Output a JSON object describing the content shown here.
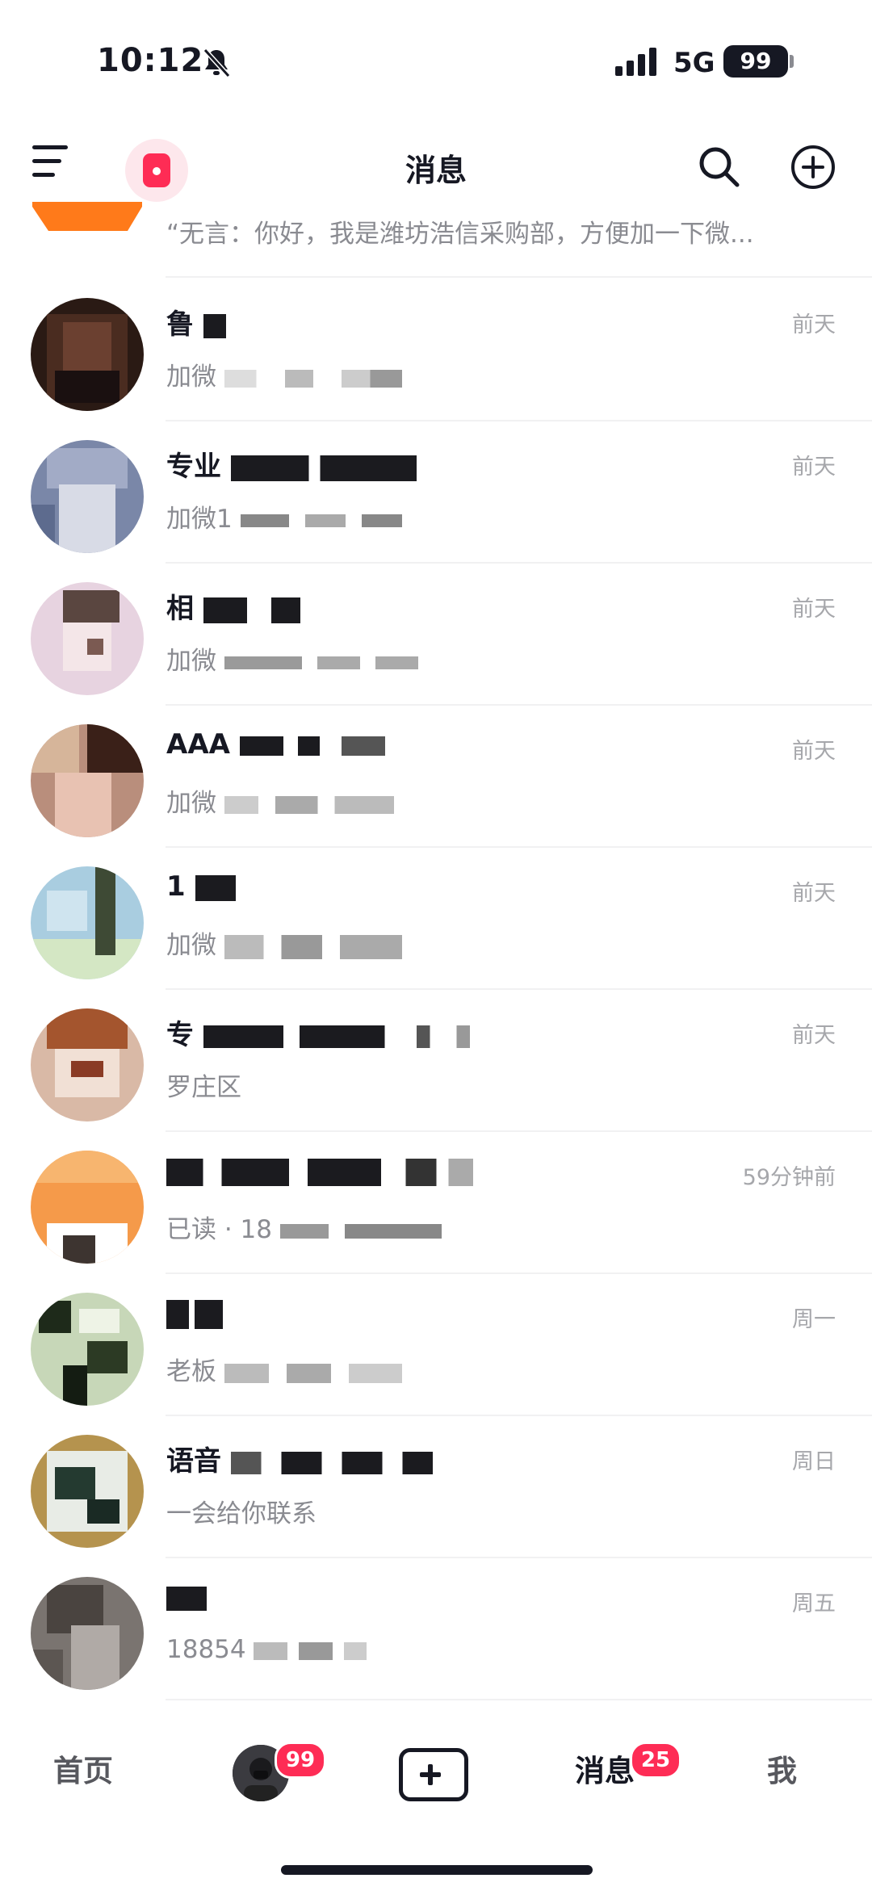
{
  "status_bar": {
    "time": "10:12",
    "network": "5G",
    "battery": "99"
  },
  "header": {
    "title": "消息"
  },
  "partial_item": {
    "preview": "“无言：你好，我是潍坊浩信采购部，方便加一下微..."
  },
  "conversations": [
    {
      "name": "鲁",
      "preview": "加微",
      "time": "前天"
    },
    {
      "name": "专业",
      "preview": "加微1",
      "time": "前天"
    },
    {
      "name": "相",
      "preview": "加微",
      "time": "前天"
    },
    {
      "name": "AAA",
      "preview": "加微",
      "time": "前天"
    },
    {
      "name": "1",
      "preview": "加微",
      "time": "前天"
    },
    {
      "name": "专",
      "preview": "罗庄区",
      "time": "前天"
    },
    {
      "name": "",
      "preview": "已读 · 18",
      "time": "59分钟前"
    },
    {
      "name": "",
      "preview": "老板",
      "time": "周一"
    },
    {
      "name": "语音",
      "preview": "一会给你联系",
      "time": "周日"
    },
    {
      "name": "",
      "preview": "18854",
      "time": "周五"
    }
  ],
  "bottom_nav": {
    "home": "首页",
    "friends_badge": "99",
    "messages": "消息",
    "messages_badge": "25",
    "me": "我"
  },
  "colors": {
    "accent": "#fe2c55",
    "text_primary": "#161823",
    "text_secondary": "#8a8b91",
    "time_text": "#a6a7ab"
  }
}
